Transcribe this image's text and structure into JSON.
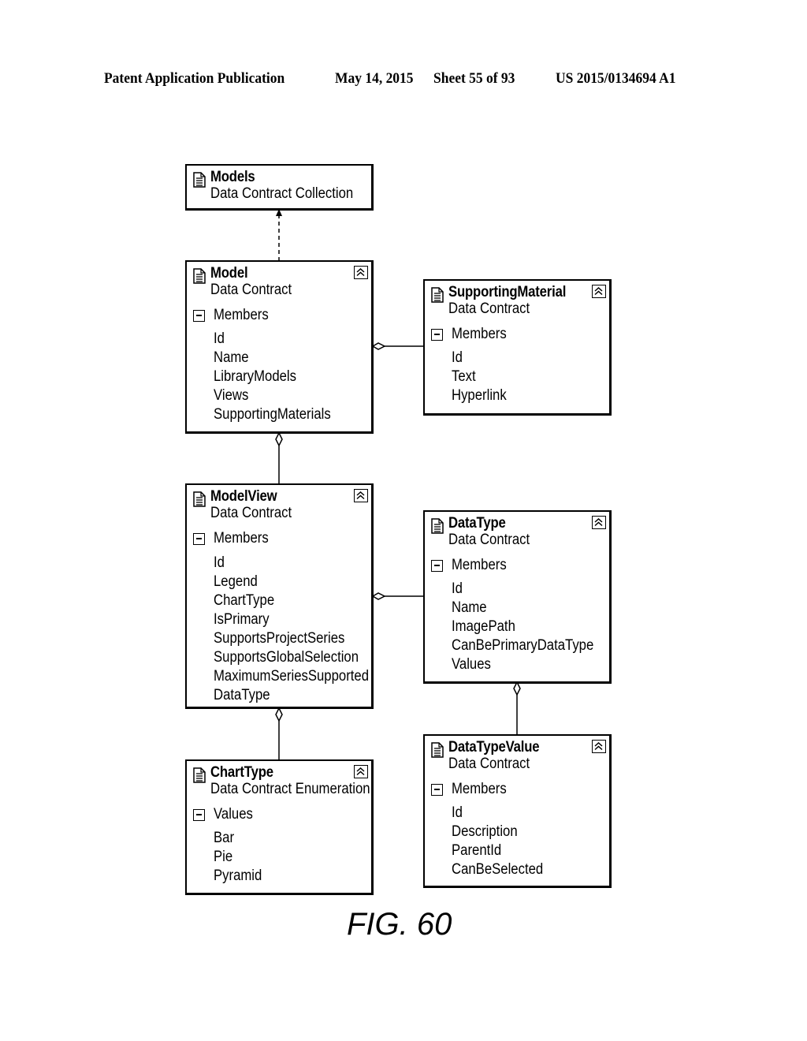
{
  "header": {
    "publication": "Patent Application Publication",
    "date": "May 14, 2015",
    "sheet": "Sheet 55 of 93",
    "number": "US 2015/0134694 A1"
  },
  "boxes": {
    "models": {
      "title": "Models",
      "subtitle": "Data Contract Collection"
    },
    "model": {
      "title": "Model",
      "subtitle": "Data Contract",
      "section": "Members",
      "items": [
        "Id",
        "Name",
        "LibraryModels",
        "Views",
        "SupportingMaterials"
      ]
    },
    "supporting_material": {
      "title": "SupportingMaterial",
      "subtitle": "Data Contract",
      "section": "Members",
      "items": [
        "Id",
        "Text",
        "Hyperlink"
      ]
    },
    "model_view": {
      "title": "ModelView",
      "subtitle": "Data Contract",
      "section": "Members",
      "items": [
        "Id",
        "Legend",
        "ChartType",
        "IsPrimary",
        "SupportsProjectSeries",
        "SupportsGlobalSelection",
        "MaximumSeriesSupported",
        "DataType"
      ]
    },
    "data_type": {
      "title": "DataType",
      "subtitle": "Data Contract",
      "section": "Members",
      "items": [
        "Id",
        "Name",
        "ImagePath",
        "CanBePrimaryDataType",
        "Values"
      ]
    },
    "chart_type": {
      "title": "ChartType",
      "subtitle": "Data Contract Enumeration",
      "section": "Values",
      "items": [
        "Bar",
        "Pie",
        "Pyramid"
      ]
    },
    "data_type_value": {
      "title": "DataTypeValue",
      "subtitle": "Data Contract",
      "section": "Members",
      "items": [
        "Id",
        "Description",
        "ParentId",
        "CanBeSelected"
      ]
    }
  },
  "connectors": [
    {
      "from": "Model",
      "to": "Models",
      "kind": "dependency"
    },
    {
      "from": "SupportingMaterial",
      "to": "Model",
      "kind": "aggregation"
    },
    {
      "from": "ModelView",
      "to": "Model",
      "kind": "aggregation"
    },
    {
      "from": "DataType",
      "to": "ModelView",
      "kind": "aggregation"
    },
    {
      "from": "ChartType",
      "to": "ModelView",
      "kind": "aggregation"
    },
    {
      "from": "DataTypeValue",
      "to": "DataType",
      "kind": "aggregation"
    }
  ],
  "figure_label": "FIG. 60"
}
